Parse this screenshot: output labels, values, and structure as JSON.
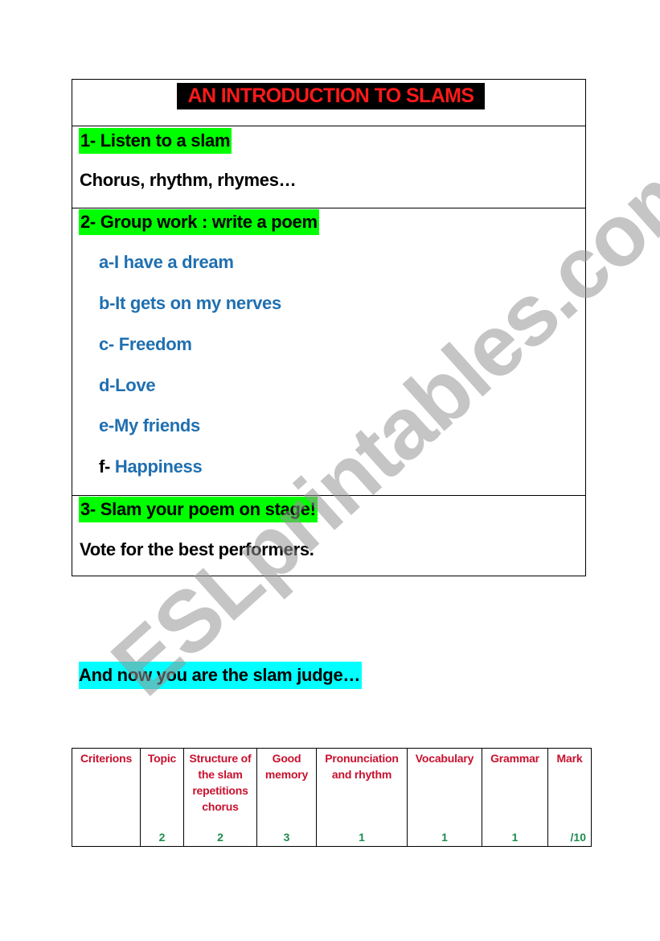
{
  "document": {
    "title": "AN INTRODUCTION TO SLAMS",
    "sections": [
      {
        "heading": "1- Listen to a slam",
        "text": "Chorus, rhythm, rhymes…"
      },
      {
        "heading": "2- Group work : write a poem",
        "topics": [
          {
            "prefix": "a-",
            "label": "I have a dream"
          },
          {
            "prefix": "b-",
            "label": "It gets on my nerves"
          },
          {
            "prefix": "c- ",
            "label": "Freedom"
          },
          {
            "prefix": "d-",
            "label": "Love"
          },
          {
            "prefix": "e-",
            "label": "My friends"
          },
          {
            "prefix": "f- ",
            "label": "Happiness"
          }
        ]
      },
      {
        "heading": "3- Slam your poem on stage!",
        "text": "Vote for the best performers."
      }
    ],
    "judge_heading": "And now you are the slam judge…"
  },
  "rubric": {
    "columns": [
      {
        "header": "Criterions",
        "points": ""
      },
      {
        "header": "Topic",
        "points": "2"
      },
      {
        "header": "Structure of the slam repetitions chorus",
        "points": "2"
      },
      {
        "header": "Good memory",
        "points": "3"
      },
      {
        "header": "Pronunciation and rhythm",
        "points": "1"
      },
      {
        "header": "Vocabulary",
        "points": "1"
      },
      {
        "header": "Grammar",
        "points": "1"
      },
      {
        "header": "Mark",
        "points": "/10"
      }
    ]
  },
  "watermark": "ESLprintables.com",
  "colors": {
    "title_text": "#ff1a1a",
    "title_bg": "#000000",
    "section_highlight": "#00ff00",
    "judge_highlight": "#00ffff",
    "topic_text": "#1f6fb0",
    "rubric_header": "#c8102e",
    "rubric_points": "#1e8c4e"
  }
}
